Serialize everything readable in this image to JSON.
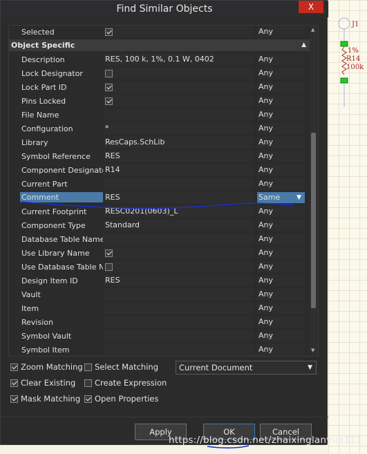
{
  "window": {
    "title": "Find Similar Objects",
    "close_label": "X"
  },
  "section_header": "Object Specific",
  "top_row": {
    "label": "Selected",
    "checked": true,
    "match": "Any"
  },
  "rows": [
    {
      "label": "Description",
      "value": "RES, 100 k, 1%, 0.1 W, 0402",
      "match": "Any"
    },
    {
      "label": "Lock Designator",
      "checkbox": true,
      "checked": false,
      "match": "Any"
    },
    {
      "label": "Lock Part ID",
      "checkbox": true,
      "checked": true,
      "match": "Any"
    },
    {
      "label": "Pins Locked",
      "checkbox": true,
      "checked": true,
      "match": "Any"
    },
    {
      "label": "File Name",
      "value": "",
      "match": "Any"
    },
    {
      "label": "Configuration",
      "value": "*",
      "match": "Any"
    },
    {
      "label": "Library",
      "value": "ResCaps.SchLib",
      "match": "Any"
    },
    {
      "label": "Symbol Reference",
      "value": "RES",
      "match": "Any"
    },
    {
      "label": "Component Designato",
      "value": "R14",
      "match": "Any"
    },
    {
      "label": "Current Part",
      "value": "",
      "match": "Any"
    },
    {
      "label": "Comment",
      "value": "RES",
      "match": "Same",
      "highlight": true
    },
    {
      "label": "Current Footprint",
      "value": "RESC0201(0603)_L",
      "match": "Any"
    },
    {
      "label": "Component Type",
      "value": "Standard",
      "match": "Any"
    },
    {
      "label": "Database Table Name",
      "value": "",
      "match": "Any"
    },
    {
      "label": "Use Library Name",
      "checkbox": true,
      "checked": true,
      "match": "Any"
    },
    {
      "label": "Use Database Table Na",
      "checkbox": true,
      "checked": false,
      "match": "Any"
    },
    {
      "label": "Design Item ID",
      "value": "RES",
      "match": "Any"
    },
    {
      "label": "Vault",
      "value": "",
      "match": "Any"
    },
    {
      "label": "Item",
      "value": "",
      "match": "Any"
    },
    {
      "label": "Revision",
      "value": "",
      "match": "Any"
    },
    {
      "label": "Symbol Vault",
      "value": "",
      "match": "Any"
    },
    {
      "label": "Symbol Item",
      "value": "",
      "match": "Any"
    }
  ],
  "options": {
    "zoom_matching": {
      "label": "Zoom Matching",
      "checked": true
    },
    "select_matching": {
      "label": "Select Matching",
      "checked": false
    },
    "clear_existing": {
      "label": "Clear Existing",
      "checked": true
    },
    "create_expression": {
      "label": "Create Expression",
      "checked": false
    },
    "mask_matching": {
      "label": "Mask Matching",
      "checked": true
    },
    "open_properties": {
      "label": "Open Properties",
      "checked": true
    }
  },
  "scope_select": {
    "value": "Current Document"
  },
  "buttons": {
    "apply": "Apply",
    "ok": "OK",
    "cancel": "Cancel"
  },
  "watermark": "https://blog.csdn.net/zhaixinglanyue111",
  "schematic": {
    "designator": "R14",
    "tolerance": "1%",
    "value": "100k",
    "tag": "J1"
  },
  "colors": {
    "highlight": "#4a7aa8",
    "dialog_bg": "#2b2b2b",
    "close": "#c42b1c",
    "annotation": "#1a2fc9"
  }
}
